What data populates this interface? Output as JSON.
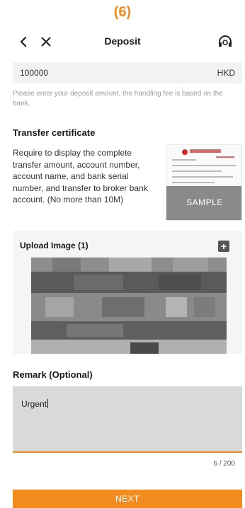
{
  "step_label": "(6)",
  "header": {
    "back_icon": "chevron-left-icon",
    "close_icon": "close-icon",
    "title": "Deposit",
    "support_icon": "headset-icon"
  },
  "amount": {
    "value": "100000",
    "currency": "HKD"
  },
  "amount_hint": "Please enter your deposit amount, the handling fee is based on the bank.",
  "transfer_certificate": {
    "title": "Transfer certificate",
    "description": "Require to display the complete transfer amount, account number, account name, and bank serial number, and transfer to broker bank account. (No more than 10M)",
    "sample_label": "SAMPLE"
  },
  "upload": {
    "label": "Upload Image (1)",
    "add_icon": "plus-icon"
  },
  "remark": {
    "title": "Remark (Optional)",
    "value": "Urgent",
    "counter": "6 / 200"
  },
  "next_button": "NEXT",
  "colors": {
    "accent": "#f28c1e",
    "step_label": "#f08a1c"
  }
}
